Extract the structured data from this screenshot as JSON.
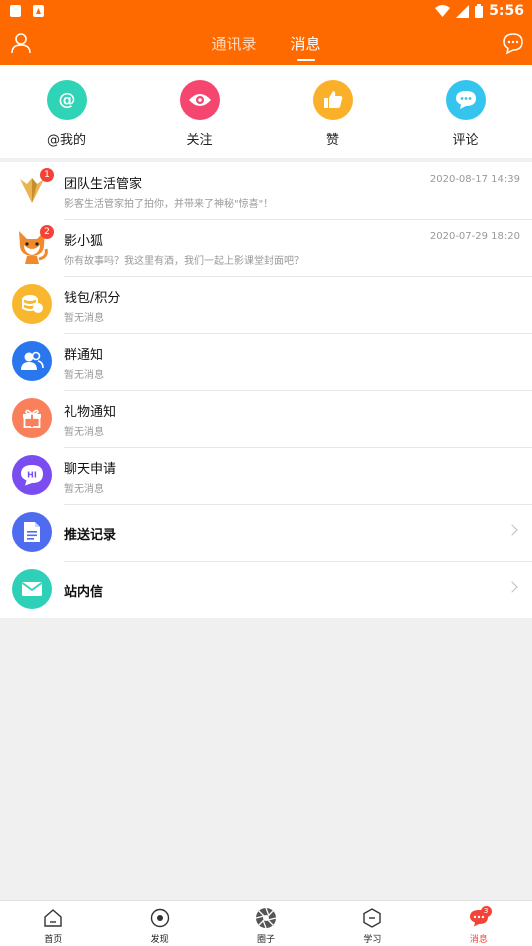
{
  "status_bar": {
    "time": "5:56"
  },
  "header": {
    "tabs": [
      {
        "label": "通讯录",
        "active": false
      },
      {
        "label": "消息",
        "active": true
      }
    ]
  },
  "quick_actions": [
    {
      "label": "@我的",
      "icon": "at-icon",
      "color": "#2fd3b5"
    },
    {
      "label": "关注",
      "icon": "eye-icon",
      "color": "#f5466f"
    },
    {
      "label": "赞",
      "icon": "thumbs-up-icon",
      "color": "#fbb02a"
    },
    {
      "label": "评论",
      "icon": "comment-icon",
      "color": "#35c4ee"
    }
  ],
  "messages": [
    {
      "title": "团队生活管家",
      "subtitle": "影客生活管家拍了拍你，并带来了神秘\"惊喜\"！",
      "time": "2020-08-17 14:39",
      "badge": "1",
      "icon": "shield-v-icon"
    },
    {
      "title": "影小狐",
      "subtitle": "你有故事吗？我这里有酒，我们一起上影课堂封面吧？",
      "time": "2020-07-29 18:20",
      "badge": "2",
      "icon": "fox-icon"
    },
    {
      "title": "钱包/积分",
      "subtitle": "暂无消息",
      "icon": "coins-icon",
      "color": "#f9b72d"
    },
    {
      "title": "群通知",
      "subtitle": "暂无消息",
      "icon": "group-icon",
      "color": "#2a76ee"
    },
    {
      "title": "礼物通知",
      "subtitle": "暂无消息",
      "icon": "gift-icon",
      "color": "#f9805a"
    },
    {
      "title": "聊天申请",
      "subtitle": "暂无消息",
      "icon": "hi-bubble-icon",
      "color": "#7a4df0",
      "icon_text": "HI"
    }
  ],
  "links": [
    {
      "title": "推送记录",
      "icon": "document-icon",
      "color": "#4f6cf0"
    },
    {
      "title": "站内信",
      "icon": "mail-icon",
      "color": "#2fd0b8"
    }
  ],
  "bottom_nav": [
    {
      "label": "首页",
      "icon": "home-icon"
    },
    {
      "label": "发现",
      "icon": "discover-icon"
    },
    {
      "label": "圈子",
      "icon": "aperture-icon"
    },
    {
      "label": "学习",
      "icon": "study-icon"
    },
    {
      "label": "消息",
      "icon": "message-icon",
      "active": true,
      "badge": "3"
    }
  ],
  "colors": {
    "brand": "#ff6a00",
    "badge": "#f44336",
    "active_tab": "#f44336"
  }
}
